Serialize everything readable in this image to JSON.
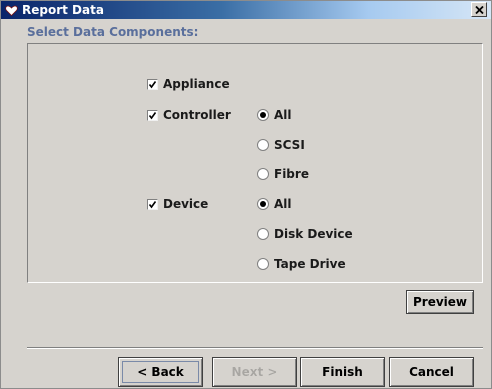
{
  "window": {
    "title": "Report Data",
    "close_label": "×"
  },
  "section": {
    "label": "Select Data Components:"
  },
  "options": {
    "appliance": {
      "label": "Appliance",
      "checked": true
    },
    "controller": {
      "label": "Controller",
      "checked": true,
      "radios": [
        "All",
        "SCSI",
        "Fibre"
      ],
      "selected": "All"
    },
    "device": {
      "label": "Device",
      "checked": true,
      "radios": [
        "All",
        "Disk Device",
        "Tape Drive"
      ],
      "selected": "All"
    }
  },
  "buttons": {
    "preview": "Preview",
    "back": "< Back",
    "next": "Next >",
    "finish": "Finish",
    "cancel": "Cancel"
  },
  "icons": {
    "title": "heart-icon",
    "close": "close-icon",
    "check": "check-icon"
  },
  "colors": {
    "title_gradient_start": "#0a246a",
    "title_gradient_end": "#d6e6f6",
    "dialog_background": "#d6d3ce",
    "section_label": "#5a6f9c",
    "disabled_text": "#a8a6a2"
  }
}
